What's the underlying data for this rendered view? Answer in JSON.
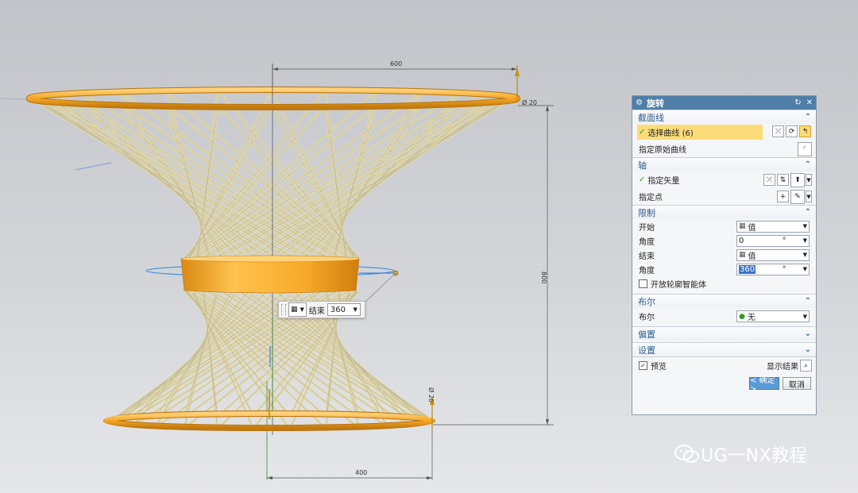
{
  "viewport": {
    "dimensions": {
      "top_width": "600",
      "bottom_width": "400",
      "height": "800",
      "top_tube": "Ø 20",
      "bottom_tube": "Ø 20"
    },
    "mini_toolbar": {
      "end_label": "结束",
      "end_value": "360"
    }
  },
  "dialog": {
    "title": "旋转",
    "sections": {
      "section_curve": {
        "title": "截面线",
        "select_curve": "选择曲线 (6)",
        "specify_original": "指定原始曲线"
      },
      "axis": {
        "title": "轴",
        "specify_vector": "指定矢量",
        "specify_point": "指定点"
      },
      "limits": {
        "title": "限制",
        "start_label": "开始",
        "start_value": "值",
        "start_angle_label": "角度",
        "start_angle": "0",
        "end_label": "结束",
        "end_value": "值",
        "end_angle_label": "角度",
        "end_angle": "360",
        "unit": "°",
        "open_profile": "开放轮廓智能体"
      },
      "boolean": {
        "title": "布尔",
        "label": "布尔",
        "value": "无"
      },
      "offset": {
        "title": "偏置"
      },
      "settings": {
        "title": "设置"
      }
    },
    "preview_label": "预览",
    "show_result": "显示结果",
    "ok_button": "< 确定 >",
    "cancel_button": "取消"
  },
  "watermark": "UG一NX教程",
  "colors": {
    "orange": "#f5a623",
    "lattice": "#e6d9a3",
    "title_bar": "#4f7fa8",
    "highlight": "#fbdc78",
    "section_text": "#2f5c91"
  }
}
